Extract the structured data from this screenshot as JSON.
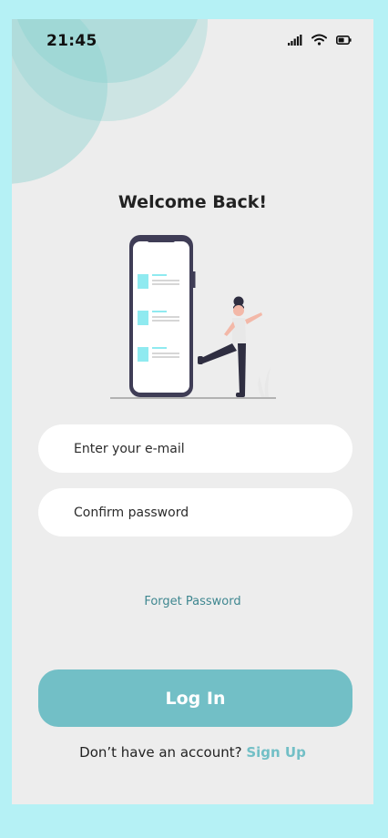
{
  "status": {
    "time": "21:45",
    "signal_icon": "signal-bars-icon",
    "wifi_icon": "wifi-icon",
    "battery_icon": "battery-icon"
  },
  "title": "Welcome Back!",
  "email": {
    "placeholder": "Enter your e-mail"
  },
  "password": {
    "placeholder": "Confirm password"
  },
  "forgot_label": "Forget Password",
  "login_label": "Log In",
  "signup": {
    "prompt": "Don’t have an account?",
    "link": "Sign Up"
  },
  "colors": {
    "accent": "#72bfc6",
    "background": "#ededed",
    "outer": "#b5f1f5"
  }
}
